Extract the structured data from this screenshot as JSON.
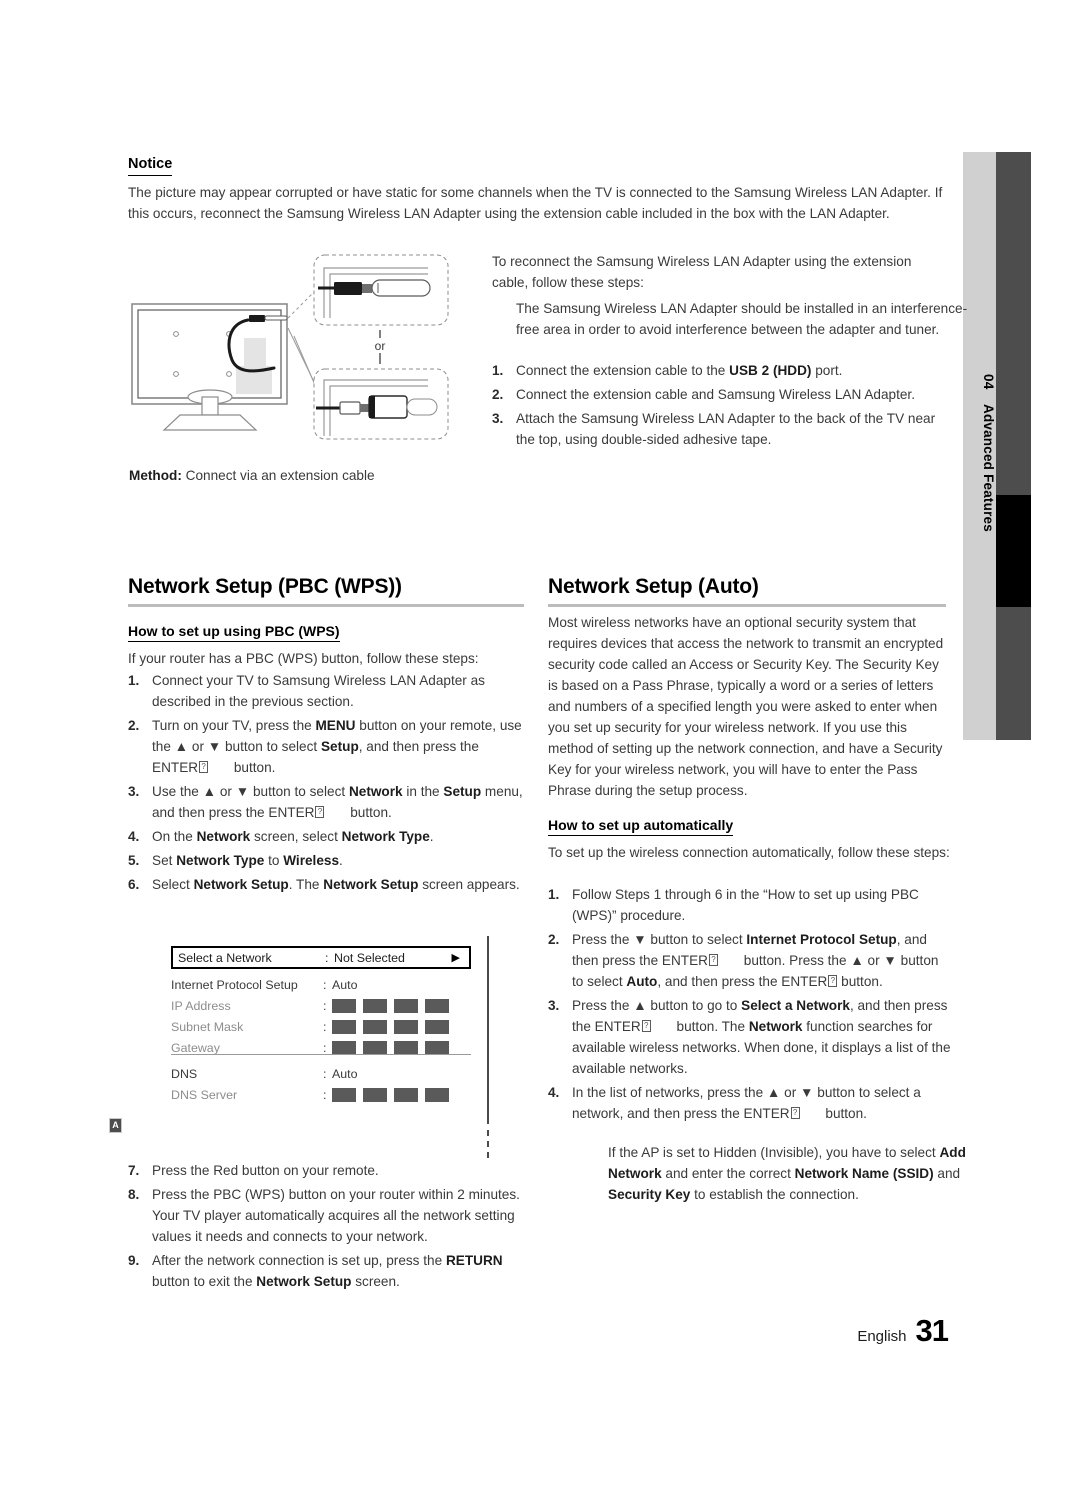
{
  "chapter_tab": {
    "number": "04",
    "label": "Advanced Features"
  },
  "notice": {
    "heading": "Notice",
    "body": "The picture may appear corrupted or have static for some channels when the TV is connected to the Samsung Wireless LAN Adapter. If this occurs, reconnect the Samsung Wireless LAN Adapter using the extension cable included in the box with the LAN Adapter."
  },
  "illustration": {
    "or_label": "or",
    "method_bold": "Method:",
    "method_text": " Connect via an extension cable"
  },
  "reconnect": {
    "intro": "To reconnect the Samsung Wireless LAN Adapter using the extension cable, follow these steps:",
    "note": "The Samsung Wireless LAN Adapter should be installed in an interference-free area in order to avoid interference between the adapter and tuner.",
    "steps": [
      {
        "num": "1.",
        "parts": [
          {
            "t": "Connect the extension cable to the "
          },
          {
            "t": "USB 2 (HDD)",
            "b": true
          },
          {
            "t": " port."
          }
        ]
      },
      {
        "num": "2.",
        "parts": [
          {
            "t": "Connect the extension cable and Samsung Wireless LAN Adapter."
          }
        ]
      },
      {
        "num": "3.",
        "parts": [
          {
            "t": "Attach the Samsung Wireless LAN Adapter to the back of the TV near the top, using double-sided adhesive tape."
          }
        ]
      }
    ]
  },
  "pbc": {
    "title": "Network Setup (PBC (WPS))",
    "sub_title": "How to set up using PBC (WPS)",
    "lead": "If your router has a PBC (WPS) button, follow these steps:",
    "steps": [
      {
        "num": "1.",
        "parts": [
          {
            "t": "Connect your TV to Samsung Wireless LAN Adapter as described in the previous section."
          }
        ]
      },
      {
        "num": "2.",
        "parts": [
          {
            "t": "Turn on your TV, press the "
          },
          {
            "t": "MENU",
            "b": true
          },
          {
            "t": " button on your remote, use the ▲ or ▼ button to select "
          },
          {
            "t": "Setup",
            "b": true
          },
          {
            "t": ", and then press the ENTER"
          },
          {
            "tofu": true
          },
          {
            "gap": true
          },
          {
            "t": " button."
          }
        ]
      },
      {
        "num": "3.",
        "parts": [
          {
            "t": "Use the ▲ or ▼ button to select "
          },
          {
            "t": "Network",
            "b": true
          },
          {
            "t": " in the "
          },
          {
            "t": "Setup",
            "b": true
          },
          {
            "t": " menu, and then press the ENTER"
          },
          {
            "tofu": true
          },
          {
            "gap": true
          },
          {
            "t": " button."
          }
        ]
      },
      {
        "num": "4.",
        "parts": [
          {
            "t": "On the "
          },
          {
            "t": "Network",
            "b": true
          },
          {
            "t": " screen, select "
          },
          {
            "t": "Network Type",
            "b": true
          },
          {
            "t": "."
          }
        ]
      },
      {
        "num": "5.",
        "parts": [
          {
            "t": "Set "
          },
          {
            "t": "Network Type",
            "b": true
          },
          {
            "t": " to "
          },
          {
            "t": "Wireless",
            "b": true
          },
          {
            "t": "."
          }
        ]
      },
      {
        "num": "6.",
        "parts": [
          {
            "t": "Select "
          },
          {
            "t": "Network Setup",
            "b": true
          },
          {
            "t": ". The "
          },
          {
            "t": "Network Setup",
            "b": true
          },
          {
            "t": " screen appears."
          }
        ]
      }
    ],
    "steps_after": [
      {
        "num": "7.",
        "parts": [
          {
            "t": "Press the Red button on your remote."
          }
        ]
      },
      {
        "num": "8.",
        "parts": [
          {
            "t": "Press the PBC (WPS) button on your router within 2 minutes. Your TV player automatically acquires all the network setting values it needs and connects to your network."
          }
        ]
      },
      {
        "num": "9.",
        "parts": [
          {
            "t": "After the network connection is set up, press the "
          },
          {
            "t": "RETURN",
            "b": true
          },
          {
            "t": " button to exit the "
          },
          {
            "t": "Network Setup",
            "b": true
          },
          {
            "t": " screen."
          }
        ]
      }
    ]
  },
  "osd": {
    "selected_row": {
      "label": "Select a Network",
      "colon": ":",
      "value": "Not Selected",
      "arrow": "▶"
    },
    "rows": [
      {
        "label": "Internet Protocol Setup",
        "colon": ":",
        "value": "Auto",
        "type": "text",
        "dim": false
      },
      {
        "label": "IP Address",
        "colon": ":",
        "type": "blocks",
        "dim": true
      },
      {
        "label": "Subnet Mask",
        "colon": ":",
        "type": "blocks",
        "dim": true
      },
      {
        "label": "Gateway",
        "colon": ":",
        "type": "blocks",
        "dim": true
      },
      {
        "label": "DNS",
        "colon": ":",
        "value": "Auto",
        "type": "text",
        "dim": false
      },
      {
        "label": "DNS Server",
        "colon": ":",
        "type": "blocks",
        "dim": true
      }
    ],
    "red_key": "A"
  },
  "auto": {
    "title": "Network Setup (Auto)",
    "body": "Most wireless networks have an optional security system that requires devices that access the network to transmit an encrypted security code called an Access or Security Key. The Security Key is based on a Pass Phrase, typically a word or a series of letters and numbers of a specified length you were asked to enter when you set up security for your wireless network.  If you use this method of setting up the network connection, and have a Security Key for your wireless network, you will have to enter the Pass Phrase during the setup process.",
    "sub_title": "How to set up automatically",
    "lead": "To set up the wireless connection automatically, follow these steps:",
    "steps": [
      {
        "num": "1.",
        "parts": [
          {
            "t": "Follow Steps 1 through 6 in the “How to set up using PBC (WPS)” procedure."
          }
        ]
      },
      {
        "num": "2.",
        "parts": [
          {
            "t": "Press the ▼ button to select "
          },
          {
            "t": "Internet Protocol Setup",
            "b": true
          },
          {
            "t": ", and then press the ENTER"
          },
          {
            "tofu": true
          },
          {
            "gap": true
          },
          {
            "t": " button. Press the ▲ or ▼ button to select "
          },
          {
            "t": "Auto",
            "b": true
          },
          {
            "t": ", and then press the ENTER"
          },
          {
            "tofu": true
          },
          {
            "t": " button."
          }
        ]
      },
      {
        "num": "3.",
        "parts": [
          {
            "t": "Press the ▲ button to go to "
          },
          {
            "t": "Select a Network",
            "b": true
          },
          {
            "t": ", and then press the ENTER"
          },
          {
            "tofu": true
          },
          {
            "gap": true
          },
          {
            "t": " button. The "
          },
          {
            "t": "Network",
            "b": true
          },
          {
            "t": " function searches for available wireless networks. When done, it displays a list of the available networks."
          }
        ]
      },
      {
        "num": "4.",
        "parts": [
          {
            "t": "In the list of networks, press the ▲ or ▼ button to select a network, and then press the ENTER"
          },
          {
            "tofu": true
          },
          {
            "gap": true
          },
          {
            "t": " button."
          }
        ]
      }
    ],
    "note_parts": [
      {
        "t": "If the AP is set to Hidden (Invisible), you have to select "
      },
      {
        "t": "Add Network",
        "b": true
      },
      {
        "t": " and enter the correct "
      },
      {
        "t": "Network Name (SSID)",
        "b": true
      },
      {
        "t": " and "
      },
      {
        "t": "Security Key",
        "b": true
      },
      {
        "t": " to establish the connection."
      }
    ]
  },
  "footer": {
    "language": "English",
    "page": "31"
  }
}
